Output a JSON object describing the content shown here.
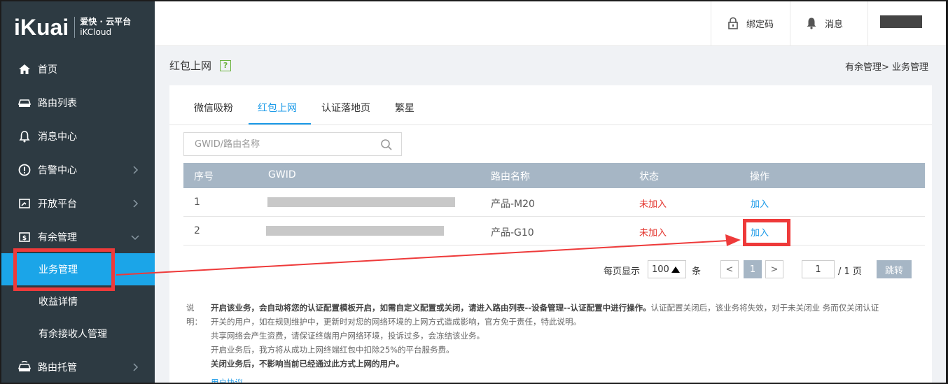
{
  "logo": {
    "main": "iKuai",
    "sub1": "爱快 · 云平台",
    "sub2": "iKCloud"
  },
  "sidebar": {
    "items": [
      {
        "label": "首页",
        "icon": "home-icon"
      },
      {
        "label": "路由列表",
        "icon": "router-icon"
      },
      {
        "label": "消息中心",
        "icon": "bell-icon"
      },
      {
        "label": "告警中心",
        "icon": "alert-icon"
      },
      {
        "label": "开放平台",
        "icon": "platform-icon"
      },
      {
        "label": "有余管理",
        "icon": "money-icon"
      },
      {
        "label": "路由托管",
        "icon": "hosting-icon"
      }
    ],
    "subitems": [
      {
        "label": "业务管理",
        "active": true
      },
      {
        "label": "收益详情"
      },
      {
        "label": "有余接收人管理"
      }
    ]
  },
  "topbar": {
    "bind_code": "绑定码",
    "messages": "消息"
  },
  "page": {
    "title": "红包上网",
    "help": "?",
    "breadcrumb": "有余管理> 业务管理"
  },
  "tabs": [
    "微信吸粉",
    "红包上网",
    "认证落地页",
    "繁星"
  ],
  "search": {
    "placeholder": "GWID/路由名称"
  },
  "table": {
    "headers": [
      "序号",
      "GWID",
      "路由名称",
      "状态",
      "操作"
    ],
    "rows": [
      {
        "index": "1",
        "name": "产品-M20",
        "status": "未加入",
        "action": "加入"
      },
      {
        "index": "2",
        "name": "产品-G10",
        "status": "未加入",
        "action": "加入"
      }
    ]
  },
  "pagination": {
    "per_page_label": "每页显示",
    "per_page": "100",
    "unit": "条",
    "prev": "<",
    "current": "1",
    "next": ">",
    "goto_value": "1",
    "total": "/ 1 页",
    "go": "跳转"
  },
  "notes": {
    "label": "说明：",
    "line1_bold": "开启该业务，会自动将您的认证配置模板开启，如需自定义配置或关闭，请进入路由列表--设备管理--认证配置中进行操作。",
    "line1_rest": "认证配置关闭后，该业务将失效，对于未关闭业 务而仅关闭认证",
    "line2": "开关的用户，如在规则维护中，更新时对您的网络环境的上网方式造成影响，官方免于责任，特此说明。",
    "line3": "共享网络会产生资费，请保证终端用户网络环境，投诉过多，会冻结该业务。",
    "line4": "开启业务后，我方将从成功上网终端红包中扣除25%的平台服务费。",
    "line5": "关闭业务后，不影响当前已经通过此方式上网的用户。",
    "agreement": "用户协议"
  },
  "colors": {
    "sidebar_bg": "#2d3a42",
    "accent": "#1b9ae8",
    "active_bg": "#1ba5e8",
    "status_red": "#e3332c",
    "highlight": "#ee3a3a",
    "table_header": "#a6b6c5"
  }
}
